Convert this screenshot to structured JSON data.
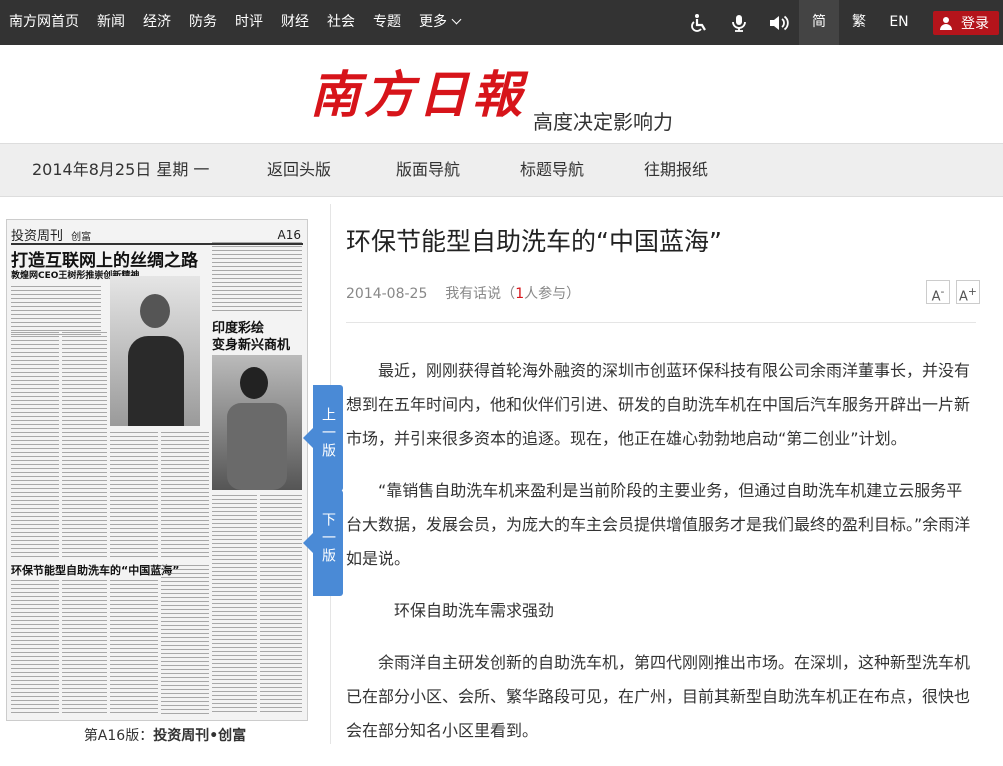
{
  "topbar": {
    "nav": [
      "南方网首页",
      "新闻",
      "经济",
      "防务",
      "时评",
      "财经",
      "社会",
      "专题"
    ],
    "more": "更多",
    "lang": [
      "简",
      "繁",
      "EN"
    ],
    "login": "登录"
  },
  "header": {
    "logo": "南方日報",
    "slogan": "高度决定影响力"
  },
  "subnav": {
    "date": "2014年8月25日 星期 一",
    "links": [
      "返回头版",
      "版面导航",
      "标题导航",
      "往期报纸"
    ]
  },
  "paper": {
    "column": "投资周刊",
    "column_sub": "创富",
    "page": "A16",
    "headline": "打造互联网上的丝绸之路",
    "subheadline": "敦煌网CEO王树彤推崇创新精神",
    "headline2_a": "印度彩绘",
    "headline2_b": "变身新兴商机",
    "headline3": "环保节能型自助洗车的“中国蓝海”",
    "caption_prefix": "第A16版：",
    "caption_name": "投资周刊•创富"
  },
  "tabs": {
    "prev": "上一版",
    "next": "下一版"
  },
  "article": {
    "title": "环保节能型自助洗车的“中国蓝海”",
    "date": "2014-08-25",
    "comment_label": "我有话说（",
    "comment_count": "1",
    "comment_suffix": "人参与）",
    "font_smaller": "A",
    "font_larger": "A",
    "paragraphs": [
      "最近，刚刚获得首轮海外融资的深圳市创蓝环保科技有限公司余雨洋董事长，并没有想到在五年时间内，他和伙伴们引进、研发的自助洗车机在中国后汽车服务开辟出一片新市场，并引来很多资本的追逐。现在，他正在雄心勃勃地启动“第二创业”计划。",
      "“靠销售自助洗车机来盈利是当前阶段的主要业务，但通过自助洗车机建立云服务平台大数据，发展会员，为庞大的车主会员提供增值服务才是我们最终的盈利目标。”余雨洋如是说。",
      "环保自助洗车需求强劲",
      "余雨洋自主研发创新的自助洗车机，第四代刚刚推出市场。在深圳，这种新型洗车机已在部分小区、会所、繁华路段可见，在广州，目前其新型自助洗车机正在布点，很快也会在部分知名小区里看到。"
    ]
  }
}
